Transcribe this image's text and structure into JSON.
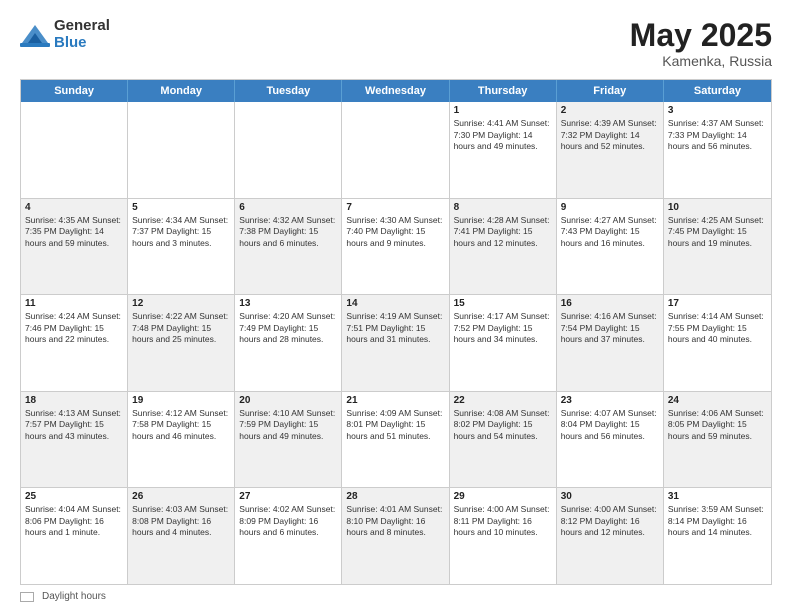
{
  "header": {
    "logo_general": "General",
    "logo_blue": "Blue",
    "title": "May 2025",
    "location": "Kamenka, Russia"
  },
  "weekdays": [
    "Sunday",
    "Monday",
    "Tuesday",
    "Wednesday",
    "Thursday",
    "Friday",
    "Saturday"
  ],
  "rows": [
    [
      {
        "day": "",
        "text": "",
        "shaded": false,
        "empty": true
      },
      {
        "day": "",
        "text": "",
        "shaded": false,
        "empty": true
      },
      {
        "day": "",
        "text": "",
        "shaded": false,
        "empty": true
      },
      {
        "day": "",
        "text": "",
        "shaded": false,
        "empty": true
      },
      {
        "day": "1",
        "text": "Sunrise: 4:41 AM\nSunset: 7:30 PM\nDaylight: 14 hours\nand 49 minutes.",
        "shaded": false
      },
      {
        "day": "2",
        "text": "Sunrise: 4:39 AM\nSunset: 7:32 PM\nDaylight: 14 hours\nand 52 minutes.",
        "shaded": true
      },
      {
        "day": "3",
        "text": "Sunrise: 4:37 AM\nSunset: 7:33 PM\nDaylight: 14 hours\nand 56 minutes.",
        "shaded": false
      }
    ],
    [
      {
        "day": "4",
        "text": "Sunrise: 4:35 AM\nSunset: 7:35 PM\nDaylight: 14 hours\nand 59 minutes.",
        "shaded": true
      },
      {
        "day": "5",
        "text": "Sunrise: 4:34 AM\nSunset: 7:37 PM\nDaylight: 15 hours\nand 3 minutes.",
        "shaded": false
      },
      {
        "day": "6",
        "text": "Sunrise: 4:32 AM\nSunset: 7:38 PM\nDaylight: 15 hours\nand 6 minutes.",
        "shaded": true
      },
      {
        "day": "7",
        "text": "Sunrise: 4:30 AM\nSunset: 7:40 PM\nDaylight: 15 hours\nand 9 minutes.",
        "shaded": false
      },
      {
        "day": "8",
        "text": "Sunrise: 4:28 AM\nSunset: 7:41 PM\nDaylight: 15 hours\nand 12 minutes.",
        "shaded": true
      },
      {
        "day": "9",
        "text": "Sunrise: 4:27 AM\nSunset: 7:43 PM\nDaylight: 15 hours\nand 16 minutes.",
        "shaded": false
      },
      {
        "day": "10",
        "text": "Sunrise: 4:25 AM\nSunset: 7:45 PM\nDaylight: 15 hours\nand 19 minutes.",
        "shaded": true
      }
    ],
    [
      {
        "day": "11",
        "text": "Sunrise: 4:24 AM\nSunset: 7:46 PM\nDaylight: 15 hours\nand 22 minutes.",
        "shaded": false
      },
      {
        "day": "12",
        "text": "Sunrise: 4:22 AM\nSunset: 7:48 PM\nDaylight: 15 hours\nand 25 minutes.",
        "shaded": true
      },
      {
        "day": "13",
        "text": "Sunrise: 4:20 AM\nSunset: 7:49 PM\nDaylight: 15 hours\nand 28 minutes.",
        "shaded": false
      },
      {
        "day": "14",
        "text": "Sunrise: 4:19 AM\nSunset: 7:51 PM\nDaylight: 15 hours\nand 31 minutes.",
        "shaded": true
      },
      {
        "day": "15",
        "text": "Sunrise: 4:17 AM\nSunset: 7:52 PM\nDaylight: 15 hours\nand 34 minutes.",
        "shaded": false
      },
      {
        "day": "16",
        "text": "Sunrise: 4:16 AM\nSunset: 7:54 PM\nDaylight: 15 hours\nand 37 minutes.",
        "shaded": true
      },
      {
        "day": "17",
        "text": "Sunrise: 4:14 AM\nSunset: 7:55 PM\nDaylight: 15 hours\nand 40 minutes.",
        "shaded": false
      }
    ],
    [
      {
        "day": "18",
        "text": "Sunrise: 4:13 AM\nSunset: 7:57 PM\nDaylight: 15 hours\nand 43 minutes.",
        "shaded": true
      },
      {
        "day": "19",
        "text": "Sunrise: 4:12 AM\nSunset: 7:58 PM\nDaylight: 15 hours\nand 46 minutes.",
        "shaded": false
      },
      {
        "day": "20",
        "text": "Sunrise: 4:10 AM\nSunset: 7:59 PM\nDaylight: 15 hours\nand 49 minutes.",
        "shaded": true
      },
      {
        "day": "21",
        "text": "Sunrise: 4:09 AM\nSunset: 8:01 PM\nDaylight: 15 hours\nand 51 minutes.",
        "shaded": false
      },
      {
        "day": "22",
        "text": "Sunrise: 4:08 AM\nSunset: 8:02 PM\nDaylight: 15 hours\nand 54 minutes.",
        "shaded": true
      },
      {
        "day": "23",
        "text": "Sunrise: 4:07 AM\nSunset: 8:04 PM\nDaylight: 15 hours\nand 56 minutes.",
        "shaded": false
      },
      {
        "day": "24",
        "text": "Sunrise: 4:06 AM\nSunset: 8:05 PM\nDaylight: 15 hours\nand 59 minutes.",
        "shaded": true
      }
    ],
    [
      {
        "day": "25",
        "text": "Sunrise: 4:04 AM\nSunset: 8:06 PM\nDaylight: 16 hours\nand 1 minute.",
        "shaded": false
      },
      {
        "day": "26",
        "text": "Sunrise: 4:03 AM\nSunset: 8:08 PM\nDaylight: 16 hours\nand 4 minutes.",
        "shaded": true
      },
      {
        "day": "27",
        "text": "Sunrise: 4:02 AM\nSunset: 8:09 PM\nDaylight: 16 hours\nand 6 minutes.",
        "shaded": false
      },
      {
        "day": "28",
        "text": "Sunrise: 4:01 AM\nSunset: 8:10 PM\nDaylight: 16 hours\nand 8 minutes.",
        "shaded": true
      },
      {
        "day": "29",
        "text": "Sunrise: 4:00 AM\nSunset: 8:11 PM\nDaylight: 16 hours\nand 10 minutes.",
        "shaded": false
      },
      {
        "day": "30",
        "text": "Sunrise: 4:00 AM\nSunset: 8:12 PM\nDaylight: 16 hours\nand 12 minutes.",
        "shaded": true
      },
      {
        "day": "31",
        "text": "Sunrise: 3:59 AM\nSunset: 8:14 PM\nDaylight: 16 hours\nand 14 minutes.",
        "shaded": false
      }
    ]
  ],
  "footer": {
    "daylight_label": "Daylight hours"
  }
}
